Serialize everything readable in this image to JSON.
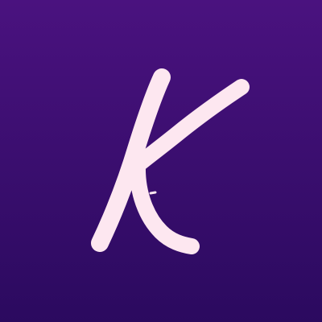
{
  "logo": {
    "letter": "K",
    "icon": "k-letter-logo-icon",
    "colors": {
      "background_top": "#4a127f",
      "background_bottom": "#2b0a5f",
      "letter": "#fde7f0"
    }
  }
}
